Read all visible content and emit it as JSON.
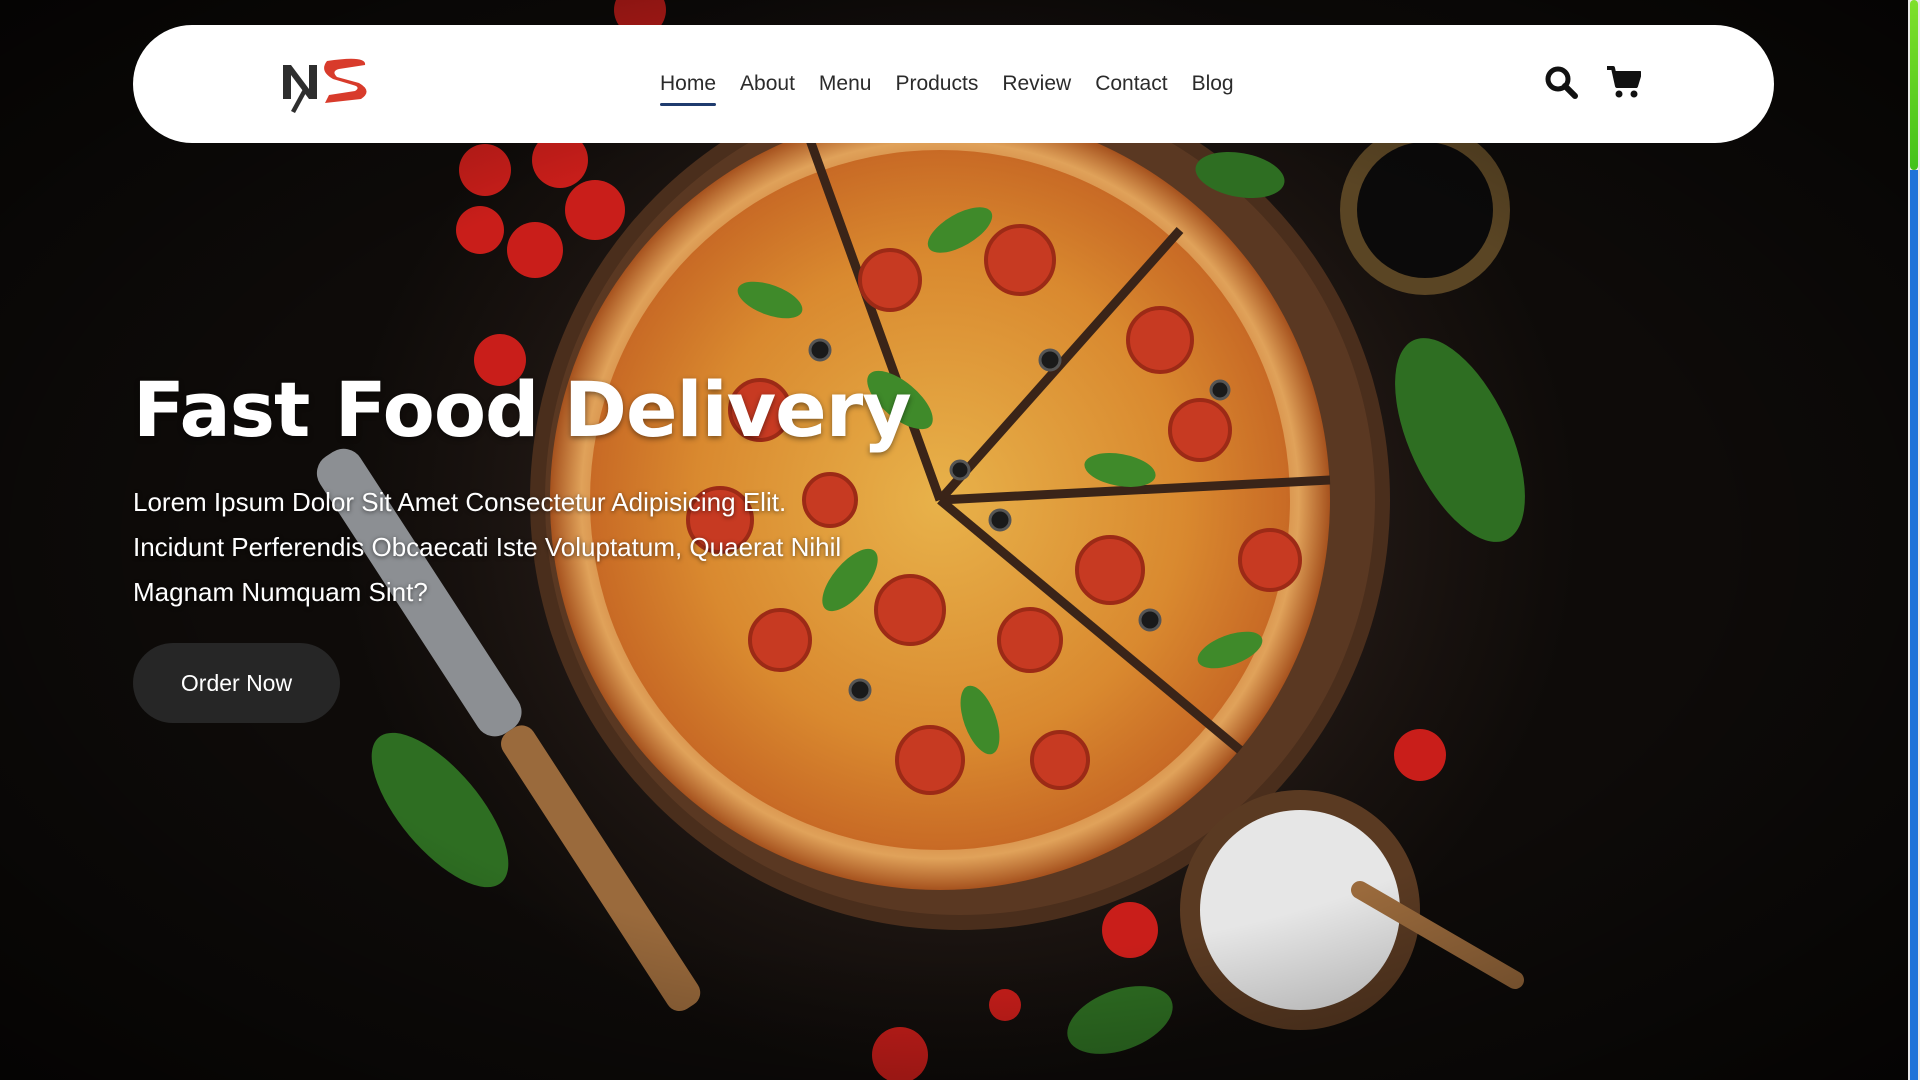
{
  "brand": {
    "logo_alt": "NS",
    "colors": {
      "logo_dark": "#2e2e2e",
      "logo_red": "#d83b2b",
      "nav_active": "#1f3b6e",
      "button_bg": "#262626"
    }
  },
  "nav": {
    "links": [
      {
        "label": "Home",
        "active": true
      },
      {
        "label": "About",
        "active": false
      },
      {
        "label": "Menu",
        "active": false
      },
      {
        "label": "Products",
        "active": false
      },
      {
        "label": "Review",
        "active": false
      },
      {
        "label": "Contact",
        "active": false
      },
      {
        "label": "Blog",
        "active": false
      }
    ],
    "icons": [
      "search-icon",
      "cart-icon"
    ]
  },
  "hero": {
    "title": "Fast Food Delivery",
    "description": "Lorem Ipsum Dolor Sit Amet Consectetur Adipisicing Elit. Incidunt Perferendis Obcaecati Iste Voluptatum, Quaerat Nihil Magnam Numquam Sint?",
    "cta_label": "Order Now"
  }
}
